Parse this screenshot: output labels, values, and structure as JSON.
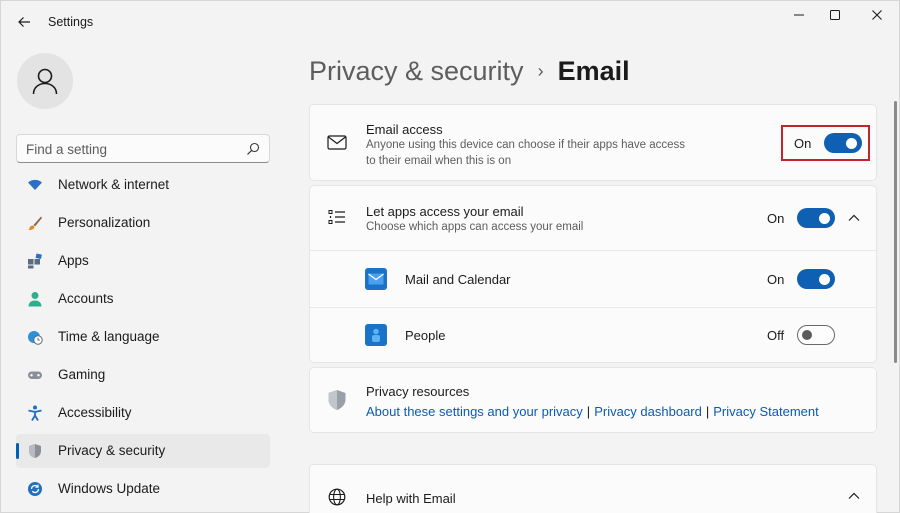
{
  "window": {
    "title": "Settings",
    "back_icon": "back-arrow-icon",
    "controls": [
      "minimize-icon",
      "maximize-icon",
      "close-icon"
    ]
  },
  "sidebar": {
    "avatar_icon": "user-icon",
    "search": {
      "placeholder": "Find a setting",
      "value": "",
      "icon": "search-icon"
    },
    "items": [
      {
        "label": "Network & internet",
        "icon": "wifi-icon",
        "active": false
      },
      {
        "label": "Personalization",
        "icon": "brush-icon",
        "active": false
      },
      {
        "label": "Apps",
        "icon": "apps-icon",
        "active": false
      },
      {
        "label": "Accounts",
        "icon": "person-icon",
        "active": false
      },
      {
        "label": "Time & language",
        "icon": "clock-globe-icon",
        "active": false
      },
      {
        "label": "Gaming",
        "icon": "gamepad-icon",
        "active": false
      },
      {
        "label": "Accessibility",
        "icon": "accessibility-icon",
        "active": false
      },
      {
        "label": "Privacy & security",
        "icon": "shield-icon",
        "active": true
      },
      {
        "label": "Windows Update",
        "icon": "update-icon",
        "active": false
      }
    ]
  },
  "main": {
    "breadcrumb": {
      "parent": "Privacy & security",
      "separator": "›",
      "current": "Email"
    },
    "email_access": {
      "icon": "mail-icon",
      "title": "Email access",
      "description": "Anyone using this device can choose if their apps have access to their email when this is on",
      "state_label": "On",
      "toggle_on": true
    },
    "let_apps": {
      "icon": "list-icon",
      "title": "Let apps access your email",
      "description": "Choose which apps can access your email",
      "state_label": "On",
      "toggle_on": true,
      "expand_icon": "chevron-up-icon",
      "apps": [
        {
          "name": "Mail and Calendar",
          "icon": "mail-calendar-app-icon",
          "state_label": "On",
          "toggle_on": true
        },
        {
          "name": "People",
          "icon": "people-app-icon",
          "state_label": "Off",
          "toggle_on": false
        }
      ]
    },
    "privacy_resources": {
      "icon": "shield-icon",
      "title": "Privacy resources",
      "links": [
        "About these settings and your privacy",
        "Privacy dashboard",
        "Privacy Statement"
      ],
      "separator": "|"
    },
    "help": {
      "icon": "globe-icon",
      "title": "Help with Email",
      "expand_icon": "chevron-up-icon"
    }
  },
  "colors": {
    "accent": "#0f5fb3",
    "link": "#0b5bb5",
    "highlight": "#c4232b",
    "background": "#f3f3f3",
    "card": "#fbfbfb"
  }
}
